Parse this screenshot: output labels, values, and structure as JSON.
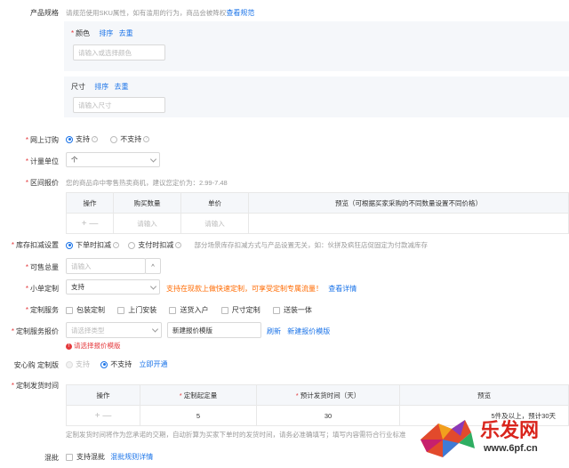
{
  "product_spec": {
    "label": "产品规格",
    "hint": "请规范使用SKU属性，如有滥用的行为，商品会被降权",
    "link": "查看规范",
    "color": {
      "label": "颜色",
      "sort": "排序",
      "dedupe": "去重",
      "placeholder": "请输入或选择颜色"
    },
    "size": {
      "label": "尺寸",
      "sort": "排序",
      "dedupe": "去重",
      "placeholder": "请输入尺寸"
    }
  },
  "online_order": {
    "label": "网上订购",
    "opt_yes": "支持",
    "opt_no": "不支持"
  },
  "unit": {
    "label": "计量单位",
    "value": "个"
  },
  "range_price": {
    "label": "区间报价",
    "hint": "您的商品命中零售热卖商机，建议您定价为：2.99-7.48",
    "headers": [
      "操作",
      "购买数量",
      "单价",
      "预览（可根据买家采购的不同数量设置不同价格）"
    ],
    "qty_placeholder": "请输入",
    "price_placeholder": "请输入",
    "plus": "+",
    "minus": "—"
  },
  "stock": {
    "label": "库存扣减设置",
    "opt_order": "下单时扣减",
    "opt_pay": "支付时扣减",
    "hint": "部分场景库存扣减方式与产品设置无关，如：伙拼及疯狂店促固定为付款减库存"
  },
  "available": {
    "label": "可售总量",
    "placeholder": "请输入"
  },
  "small_custom": {
    "label": "小单定制",
    "value": "支持",
    "orange_text": "支持在现款上做快速定制，可享受定制专属流量！",
    "link": "查看详情"
  },
  "custom_service": {
    "label": "定制服务",
    "options": [
      "包装定制",
      "上门安装",
      "送货入户",
      "尺寸定制",
      "送装一体"
    ]
  },
  "custom_quote": {
    "label": "定制服务报价",
    "select_placeholder": "请选择类型",
    "template_value": "新建报价模版",
    "refresh": "刷新",
    "new_template": "新建报价模版",
    "error": "请选择报价模版"
  },
  "anxin": {
    "label": "安心购 定制版",
    "opt_no_support": "支持",
    "opt_yes_no": "不支持",
    "link": "立即开通"
  },
  "custom_delivery": {
    "label": "定制发货时间",
    "headers": [
      "操作",
      "定制起定量",
      "预计发货时间（天）",
      "预览"
    ],
    "start_qty": "5",
    "days": "30",
    "preview": "5件及以上，预计30天",
    "plus": "+",
    "minus": "—",
    "hint": "定制发货时间将作为您承诺的交期，自动折算为买家下单时的发货时间，请务必准确填写；填写内容需符合行业标准"
  },
  "mixed": {
    "label": "混批",
    "checkbox": "支持混批",
    "link": "混批规则详情"
  },
  "watermark": {
    "text": "乐发网",
    "url": "www.6pf.cn"
  },
  "colors": {
    "accent": "#1a73e8",
    "required": "#e4393c",
    "orange": "#ff6a00",
    "panel": "#f5f7fa"
  }
}
